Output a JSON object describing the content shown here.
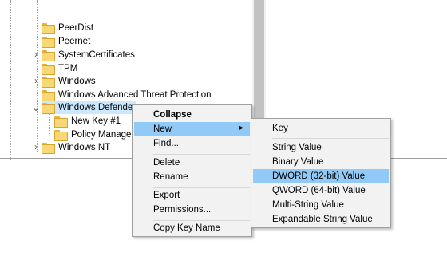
{
  "tree": {
    "items": [
      {
        "label": "PeerDist",
        "expander": ""
      },
      {
        "label": "Peernet",
        "expander": ""
      },
      {
        "label": "SystemCertificates",
        "expander": ">"
      },
      {
        "label": "TPM",
        "expander": ""
      },
      {
        "label": "Windows",
        "expander": ">"
      },
      {
        "label": "Windows Advanced Threat Protection",
        "expander": ""
      },
      {
        "label": "Windows Defende",
        "expander": "v"
      },
      {
        "label": "New Key #1",
        "expander": ""
      },
      {
        "label": "Policy Manager",
        "expander": ""
      },
      {
        "label": "Windows NT",
        "expander": ">"
      }
    ]
  },
  "context_menu": {
    "items": {
      "collapse": "Collapse",
      "new": "New",
      "find": "Find...",
      "delete": "Delete",
      "rename": "Rename",
      "export": "Export",
      "permissions": "Permissions...",
      "copy_key_name": "Copy Key Name"
    }
  },
  "submenu": {
    "items": {
      "key": "Key",
      "string_value": "String Value",
      "binary_value": "Binary Value",
      "dword_value": "DWORD (32-bit) Value",
      "qword_value": "QWORD (64-bit) Value",
      "multi_string_value": "Multi-String Value",
      "expandable_string_value": "Expandable String Value"
    },
    "highlighted": "DWORD (32-bit) Value"
  },
  "colors": {
    "selection": "#cce8ff",
    "menu_hover": "#91c9f7",
    "menu_bg": "#f2f2f2"
  }
}
